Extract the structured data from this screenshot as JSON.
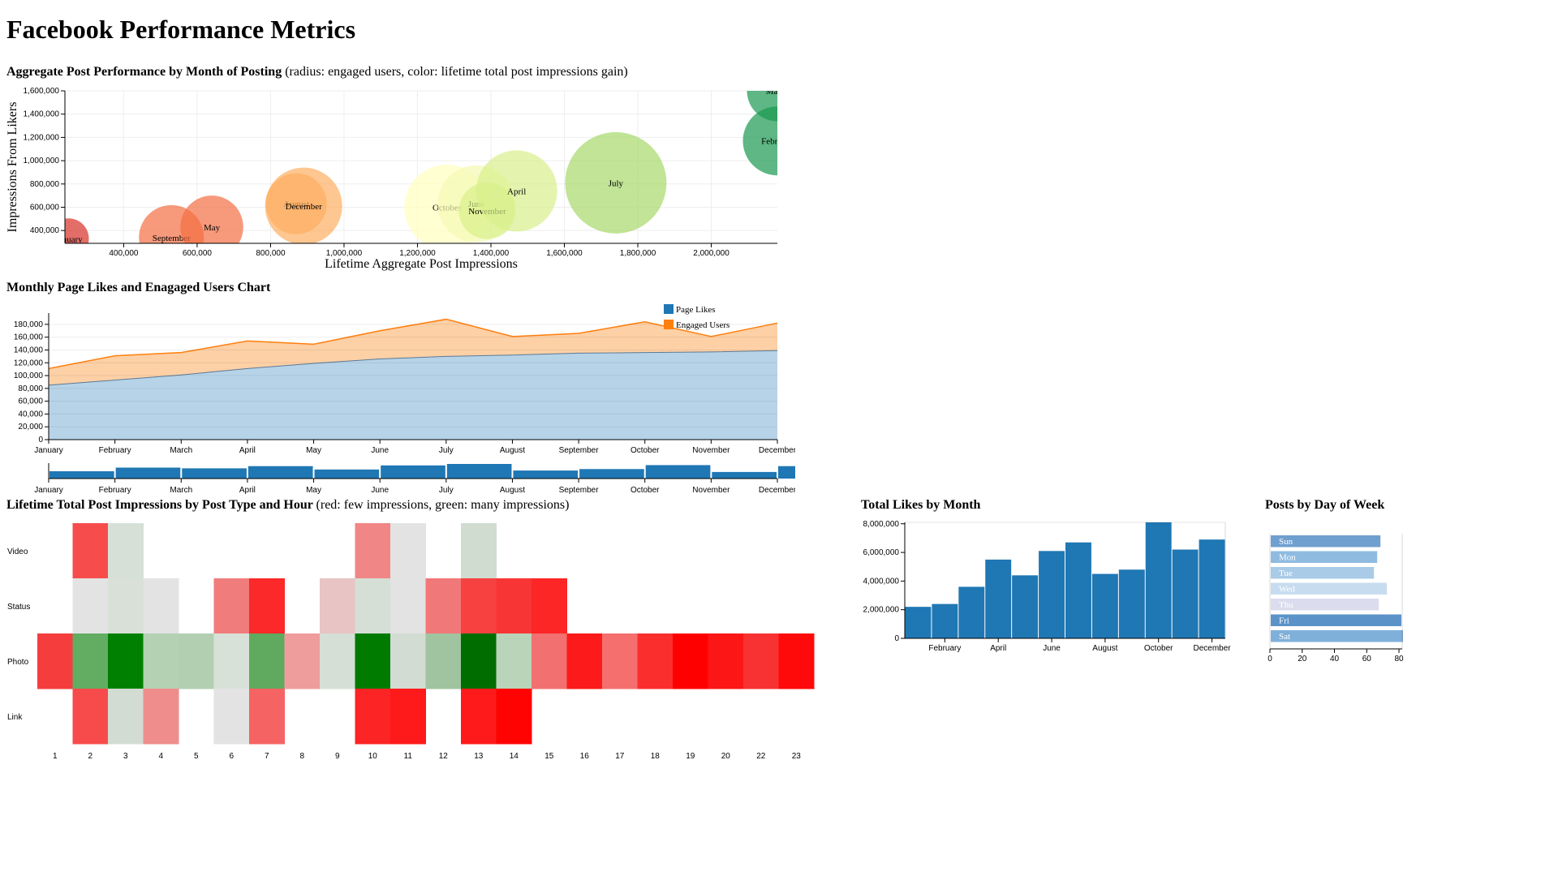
{
  "page": {
    "title": "Facebook Performance Metrics"
  },
  "chart_data": [
    {
      "id": "bubble",
      "type": "scatter",
      "title": "Aggregate Post Performance by Month of Posting",
      "subtitle": "(radius: engaged users, color: lifetime total post impressions gain)",
      "xlabel": "Lifetime Aggregate Post Impressions",
      "ylabel": "Impressions From Likers",
      "xlim": [
        240000,
        2180000
      ],
      "ylim": [
        290000,
        1600000
      ],
      "xticks": [
        400000,
        600000,
        800000,
        1000000,
        1200000,
        1400000,
        1600000,
        1800000,
        2000000
      ],
      "yticks": [
        400000,
        600000,
        800000,
        1000000,
        1200000,
        1400000,
        1600000
      ],
      "grid": true,
      "points": [
        {
          "label": "January",
          "x": 250000,
          "y": 330000,
          "r": 10000,
          "color": "#d73027"
        },
        {
          "label": "September",
          "x": 530000,
          "y": 340000,
          "r": 16000,
          "color": "#f46d43"
        },
        {
          "label": "May",
          "x": 640000,
          "y": 430000,
          "r": 15500,
          "color": "#f46d43"
        },
        {
          "label": "August",
          "x": 870000,
          "y": 630000,
          "r": 15000,
          "color": "#fdae61"
        },
        {
          "label": "December",
          "x": 890000,
          "y": 610000,
          "r": 19000,
          "color": "#fdae61"
        },
        {
          "label": "October",
          "x": 1280000,
          "y": 600000,
          "r": 21000,
          "color": "#ffffbf"
        },
        {
          "label": "June",
          "x": 1360000,
          "y": 630000,
          "r": 19000,
          "color": "#f3f9b4"
        },
        {
          "label": "November",
          "x": 1390000,
          "y": 570000,
          "r": 14000,
          "color": "#d9ef8b"
        },
        {
          "label": "April",
          "x": 1470000,
          "y": 740000,
          "r": 20000,
          "color": "#d9ef8b"
        },
        {
          "label": "July",
          "x": 1740000,
          "y": 810000,
          "r": 25000,
          "color": "#a6d96a"
        },
        {
          "label": "February",
          "x": 2180000,
          "y": 1170000,
          "r": 17000,
          "color": "#1a9850"
        },
        {
          "label": "March",
          "x": 2180000,
          "y": 1600000,
          "r": 15000,
          "color": "#1a9850"
        }
      ]
    },
    {
      "id": "area",
      "type": "area",
      "title": "Monthly Page Likes and Enagaged Users Chart",
      "categories": [
        "January",
        "February",
        "March",
        "April",
        "May",
        "June",
        "July",
        "August",
        "September",
        "October",
        "November",
        "December"
      ],
      "ylim": [
        0,
        190000
      ],
      "yticks": [
        0,
        20000,
        40000,
        60000,
        80000,
        100000,
        120000,
        140000,
        160000,
        180000
      ],
      "legend": "top-right",
      "series": [
        {
          "name": "Page Likes",
          "color": "#1f77b4",
          "fill": "#b7d3e8",
          "values": [
            85000,
            93000,
            101000,
            111000,
            119000,
            126000,
            130000,
            132000,
            135000,
            136000,
            137000,
            139000
          ]
        },
        {
          "name": "Engaged Users",
          "color": "#ff7f0e",
          "fill": "#fdd0a6",
          "values": [
            26000,
            38000,
            35000,
            43000,
            30000,
            44000,
            58000,
            29000,
            31000,
            48000,
            24000,
            43000
          ]
        }
      ],
      "brush_values": [
        0.5,
        0.75,
        0.7,
        0.85,
        0.62,
        0.9,
        1.0,
        0.55,
        0.65,
        0.92,
        0.45,
        0.85
      ]
    },
    {
      "id": "heatmap",
      "type": "heatmap",
      "title": "Lifetime Total Post Impressions by Post Type and Hour",
      "subtitle": "(red: few impressions, green: many impressions)",
      "rows": [
        "Video",
        "Status",
        "Photo",
        "Link"
      ],
      "hours": [
        1,
        2,
        3,
        4,
        5,
        6,
        7,
        8,
        9,
        10,
        11,
        12,
        13,
        14,
        15,
        16,
        17,
        18,
        19,
        20,
        22,
        23
      ],
      "cells": [
        [
          "",
          "#f64c4c",
          "#d6e0d6",
          "",
          "",
          "",
          "",
          "",
          "",
          "#f08686",
          "#e2e3e2",
          "",
          "#d1dcd1",
          "",
          "",
          "",
          "",
          "",
          "",
          "",
          "",
          ""
        ],
        [
          "",
          "#e3e3e3",
          "#d8e0d8",
          "#e3e3e3",
          "",
          "#f17c7c",
          "#fb2929",
          "",
          "#e8c4c4",
          "#d5dfd5",
          "#e2e3e2",
          "#f17878",
          "#f74141",
          "#f83535",
          "#fc2626",
          "",
          "",
          "",
          "",
          "",
          "",
          ""
        ],
        [
          "#f53d3d",
          "#63ad63",
          "#008000",
          "#b4d1b4",
          "#b2cfb2",
          "#d8e1d8",
          "#5faa5f",
          "#ef9c9c",
          "#d6dfd6",
          "#007b00",
          "#d3dcd3",
          "#9fc49f",
          "#006d00",
          "#b9d4b9",
          "#f27070",
          "#fc1a1a",
          "#f56f6f",
          "#fb2e2e",
          "#ff0000",
          "#fc1616",
          "#f83232",
          "#fe0a0a"
        ],
        [
          "",
          "#f74b4b",
          "#d2dcd2",
          "#ef8d8d",
          "",
          "#e3e3e3",
          "#f56363",
          "",
          "",
          "#fc2424",
          "#fe1a1a",
          "",
          "#fe1a1a",
          "#ff0303",
          "",
          "",
          "",
          "",
          "",
          "",
          "",
          ""
        ]
      ]
    },
    {
      "id": "likes",
      "type": "bar",
      "title": "Total Likes by Month",
      "categories": [
        "January",
        "February",
        "March",
        "April",
        "May",
        "June",
        "July",
        "August",
        "September",
        "October",
        "November",
        "December"
      ],
      "tick_labels": [
        "February",
        "April",
        "June",
        "August",
        "October",
        "December"
      ],
      "values": [
        2200000,
        2400000,
        3600000,
        5500000,
        4400000,
        6100000,
        6700000,
        4500000,
        4800000,
        8100000,
        6200000,
        6900000
      ],
      "ylim": [
        0,
        8100000
      ],
      "yticks": [
        0,
        2000000,
        4000000,
        6000000,
        8000000
      ],
      "color": "#1f77b4"
    },
    {
      "id": "days",
      "type": "bar",
      "orientation": "horizontal",
      "title": "Posts by Day of Week",
      "categories": [
        "Sun",
        "Mon",
        "Tue",
        "Wed",
        "Thu",
        "Fri",
        "Sat"
      ],
      "values": [
        68,
        66,
        64,
        72,
        67,
        81,
        82
      ],
      "colors": [
        "#6f9fcf",
        "#8fbbe0",
        "#a9cbe7",
        "#c7dcef",
        "#dcdcef",
        "#5b93c8",
        "#7fb0da"
      ],
      "xlim": [
        0,
        82
      ],
      "xticks": [
        0,
        20,
        40,
        60,
        80
      ]
    }
  ]
}
